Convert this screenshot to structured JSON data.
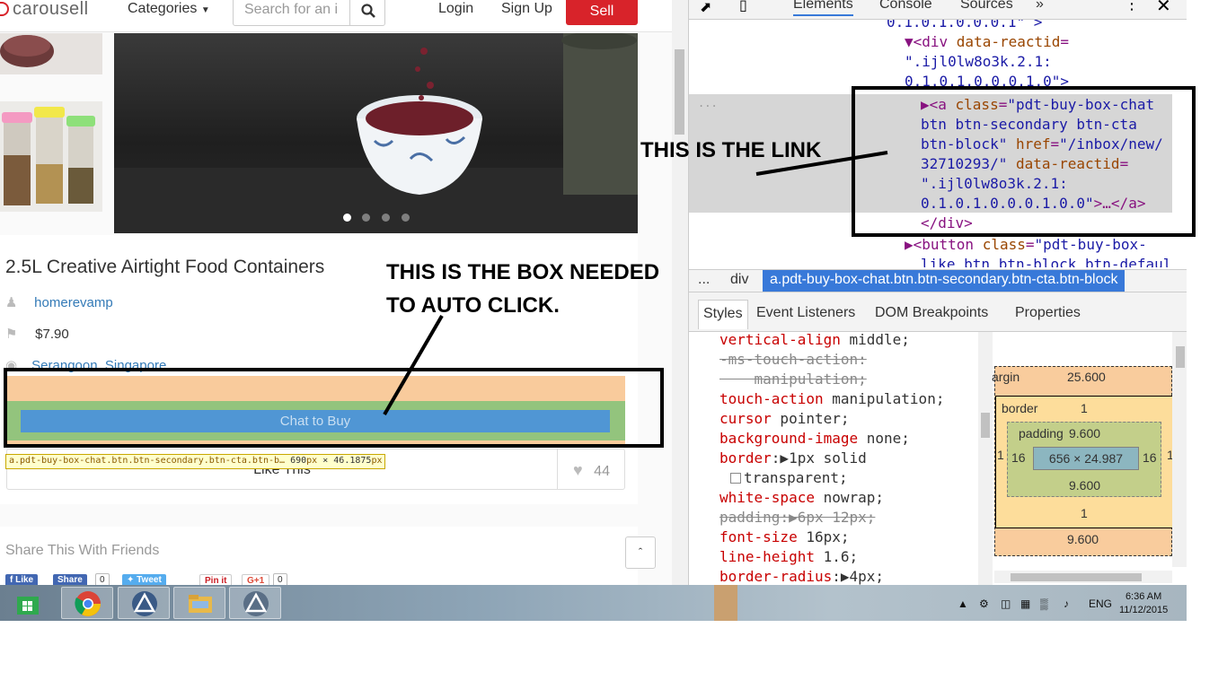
{
  "site": {
    "logo": "carousell",
    "nav": {
      "categories": "Categories",
      "search_placeholder": "Search for an i",
      "login": "Login",
      "signup": "Sign Up",
      "sell": "Sell"
    }
  },
  "product": {
    "title": "2.5L Creative Airtight Food Containers",
    "seller": "homerevamp",
    "price": "$7.90",
    "location": "Serangoon, Singapore",
    "chat_button": "Chat to Buy",
    "like_button": "Like This",
    "like_count": "44",
    "image_dots": 4
  },
  "inspect_tooltip": {
    "selector": "a.pdt-buy-box-chat.btn.btn-secondary.btn-cta.btn-b…",
    "width": "690",
    "height": "46.1875",
    "unit": "px",
    "times": "×"
  },
  "share": {
    "title": "Share This With Friends",
    "fb_like": "Like",
    "fb_share": "Share",
    "fb_count": "0",
    "tweet": "Tweet",
    "pinit": "Pin it",
    "gplus": "G+1",
    "gplus_count": "0"
  },
  "devtools": {
    "tabs": [
      "Elements",
      "Console",
      "Sources"
    ],
    "more": "»",
    "dom_lines": {
      "l1": "0.1.0.1.0.0.0.1\" >",
      "l2_tag": "▼<div ",
      "l2_attr": "data-reactid",
      "l2_eq": "=",
      "l3_val": "\".ijl0lw8o3k.2.1:",
      "l4_val": "0.1.0.1.0.0.0.1.0\">",
      "sel1_a": "▶<a ",
      "sel1_attr": "class",
      "sel1_eq": "=",
      "sel1_val": "\"pdt-buy-box-chat",
      "sel2_val": "btn btn-secondary btn-cta",
      "sel3_val": "btn-block\"",
      "sel3_attr": " href",
      "sel3_eq": "=",
      "sel3_val2": "\"/inbox/new/",
      "sel4_val": "32710293/\"",
      "sel4_attr": " data-reactid",
      "sel4_eq": "=",
      "sel5_val": "\".ijl0lw8o3k.2.1:",
      "sel6_val": "0.1.0.1.0.0.0.1.0.0\"",
      "sel6_tail": ">…</a>",
      "close_div": "</div>",
      "btn_tag": "▶<button ",
      "btn_attr": "class",
      "btn_eq": "=",
      "btn_val": "\"pdt-buy-box-",
      "btn_val2": "like btn btn-block btn-default"
    },
    "ellipsis": "...",
    "breadcrumb": [
      "...",
      "div"
    ],
    "breadcrumb_active": "a.pdt-buy-box-chat.btn.btn-secondary.btn-cta.btn-block",
    "subtabs": [
      "Styles",
      "Event Listeners",
      "DOM Breakpoints",
      "Properties"
    ],
    "styles": [
      {
        "prop": "vertical-align",
        "value": " middle;"
      },
      {
        "prop": "-ms-touch-action:",
        "value": "",
        "strike": true
      },
      {
        "prop": "    manipulation;",
        "value": "",
        "strike": true
      },
      {
        "prop": "touch-action",
        "value": " manipulation;"
      },
      {
        "prop": "cursor",
        "value": " pointer;"
      },
      {
        "prop": "background-image",
        "value": " none;"
      },
      {
        "prop": "border",
        "value": ":▶1px solid"
      },
      {
        "prop": "",
        "value": "transparent;",
        "swatch": true
      },
      {
        "prop": "white-space",
        "value": " nowrap;"
      },
      {
        "prop": "padding",
        "value": ":▶6px 12px;",
        "strike": true
      },
      {
        "prop": "font-size",
        "value": " 16px;"
      },
      {
        "prop": "line-height",
        "value": " 1.6;"
      },
      {
        "prop": "border-radius",
        "value": ":▶4px;"
      }
    ],
    "boxmodel": {
      "margin_label": "argin",
      "margin_top": "25.600",
      "border_label": "border",
      "border_top": "1",
      "padding_label": "padding",
      "padding_top": "9.600",
      "content": "656 × 24.987",
      "padding_left": "16",
      "padding_right": "16",
      "padding_bottom": "9.600",
      "border_bottom": "1",
      "margin_bottom": "9.600",
      "border_left": "1",
      "border_right": "1"
    }
  },
  "annotations": {
    "link_label": "THIS IS THE LINK",
    "box_label_1": "THIS IS THE BOX NEEDED",
    "box_label_2": "TO AUTO CLICK."
  },
  "taskbar": {
    "lang": "ENG",
    "time": "6:36 AM",
    "date": "11/12/2015"
  }
}
